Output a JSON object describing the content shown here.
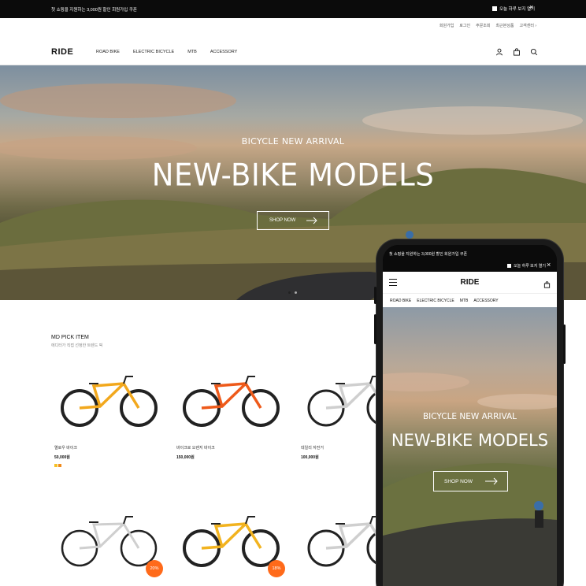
{
  "promo": {
    "message": "첫 쇼핑을 지원하는 3,000원 할인 회원가입 쿠폰",
    "close_today": "오늘 하루 보지 열기",
    "close_icon": "close-icon"
  },
  "util_links": [
    "회원가입",
    "로그인",
    "주문조회",
    "최근본상품",
    "고객센터 ›"
  ],
  "brand": "RIDE",
  "nav": [
    "ROAD BIKE",
    "ELECTRIC BICYCLE",
    "MTB",
    "ACCESSORY"
  ],
  "header_icons": [
    "user-icon",
    "bag-icon",
    "search-icon"
  ],
  "hero": {
    "subtitle": "BICYCLE NEW ARRIVAL",
    "title": "NEW-BIKE MODELS",
    "button": "SHOP NOW"
  },
  "md_pick": {
    "title": "MD PICK ITEM",
    "subtitle": "에디터가 직접 선정한 트렌드 픽",
    "products": [
      {
        "name": "옐로우 바이크",
        "price": "50,000원",
        "frame_color": "#f2a81d",
        "swatches": [
          "#f5c026",
          "#f08a1c"
        ]
      },
      {
        "name": "바이크로 오렌지 바이크",
        "price": "150,000원",
        "frame_color": "#ee5a1a"
      },
      {
        "name": "데일리 자전거",
        "price": "100,000원",
        "frame_color": "#e9e9e9"
      },
      {
        "frame_color": "#ececec",
        "badge": "20%"
      },
      {
        "frame_color": "#f2b31f",
        "badge": "18%"
      },
      {
        "frame_color": "#ececec"
      }
    ]
  },
  "mobile": {
    "promo": "첫 쇼핑을 지원하는 3,000원 할인 회원가입 쿠폰",
    "close_today": "오늘 하루 보지 열기",
    "brand": "RIDE",
    "nav": [
      "ROAD BIKE",
      "ELECTRIC BICYCLE",
      "MTB",
      "ACCESSORY"
    ],
    "hero": {
      "subtitle": "BICYCLE NEW ARRIVAL",
      "title": "NEW-BIKE MODELS",
      "button": "SHOP NOW"
    }
  }
}
